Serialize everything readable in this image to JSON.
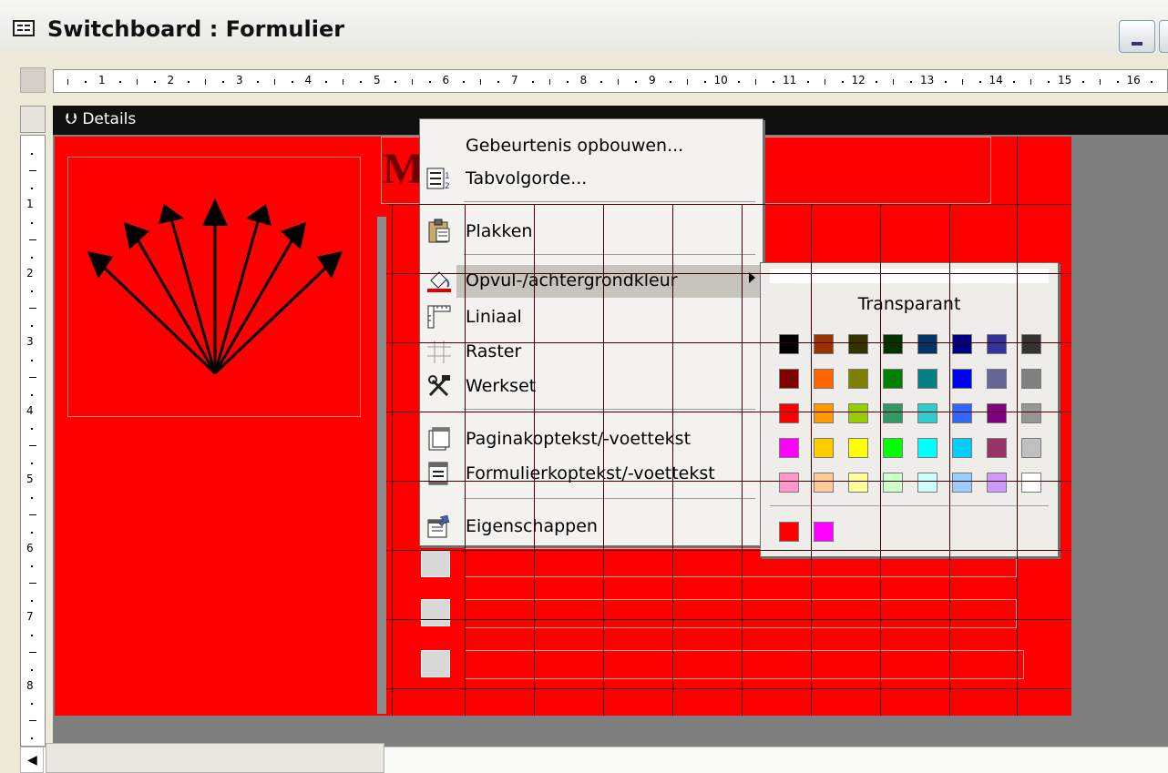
{
  "window": {
    "title": "Switchboard : Formulier",
    "controls": [
      "minimize"
    ]
  },
  "rulers": {
    "horizontal_numbers": [
      "1",
      "2",
      "3",
      "4",
      "5",
      "6",
      "7",
      "8",
      "9",
      "10",
      "11",
      "12",
      "13",
      "14",
      "15",
      "16"
    ],
    "vertical_numbers": [
      "1",
      "2",
      "3",
      "4",
      "5",
      "6",
      "7",
      "8"
    ]
  },
  "section": {
    "label": "Details"
  },
  "form_banner": {
    "text": "M           OEP"
  },
  "context_menu": {
    "items": [
      {
        "label": "Gebeurtenis opbouwen...",
        "icon": "none"
      },
      {
        "label": "Tabvolgorde...",
        "icon": "tab-order-icon"
      },
      {
        "label": "Plakken",
        "icon": "paste-icon"
      },
      {
        "label": "Opvul-/achtergrondkleur",
        "icon": "fill-color-icon",
        "highlighted": true,
        "has_submenu": true
      },
      {
        "label": "Liniaal",
        "icon": "ruler-icon"
      },
      {
        "label": "Raster",
        "icon": "grid-icon"
      },
      {
        "label": "Werkset",
        "icon": "toolbox-icon"
      },
      {
        "label": "Paginakoptekst/-voettekst",
        "icon": "page-header-icon"
      },
      {
        "label": "Formulierkoptekst/-voettekst",
        "icon": "form-header-icon"
      },
      {
        "label": "Eigenschappen",
        "icon": "properties-icon"
      }
    ]
  },
  "color_picker": {
    "transparent_label": "Transparant",
    "palette": [
      [
        "#000000",
        "#993300",
        "#333300",
        "#003300",
        "#003366",
        "#000080",
        "#333399",
        "#333333"
      ],
      [
        "#800000",
        "#ff6600",
        "#808000",
        "#008000",
        "#008080",
        "#0000ff",
        "#666699",
        "#808080"
      ],
      [
        "#ff0000",
        "#ff9900",
        "#99cc00",
        "#339966",
        "#33cccc",
        "#3366ff",
        "#800080",
        "#969696"
      ],
      [
        "#ff00ff",
        "#ffcc00",
        "#ffff00",
        "#00ff00",
        "#00ffff",
        "#00ccff",
        "#993366",
        "#c0c0c0"
      ],
      [
        "#ff99cc",
        "#ffcc99",
        "#ffff99",
        "#ccffcc",
        "#ccffff",
        "#99ccff",
        "#cc99ff",
        "#ffffff"
      ]
    ],
    "recent": [
      "#ff0000",
      "#ff00ff"
    ]
  },
  "colors": {
    "form_background": "#ff0000",
    "section_bar": "#0f0f0f",
    "menu_highlight": "#c6c4bd"
  }
}
